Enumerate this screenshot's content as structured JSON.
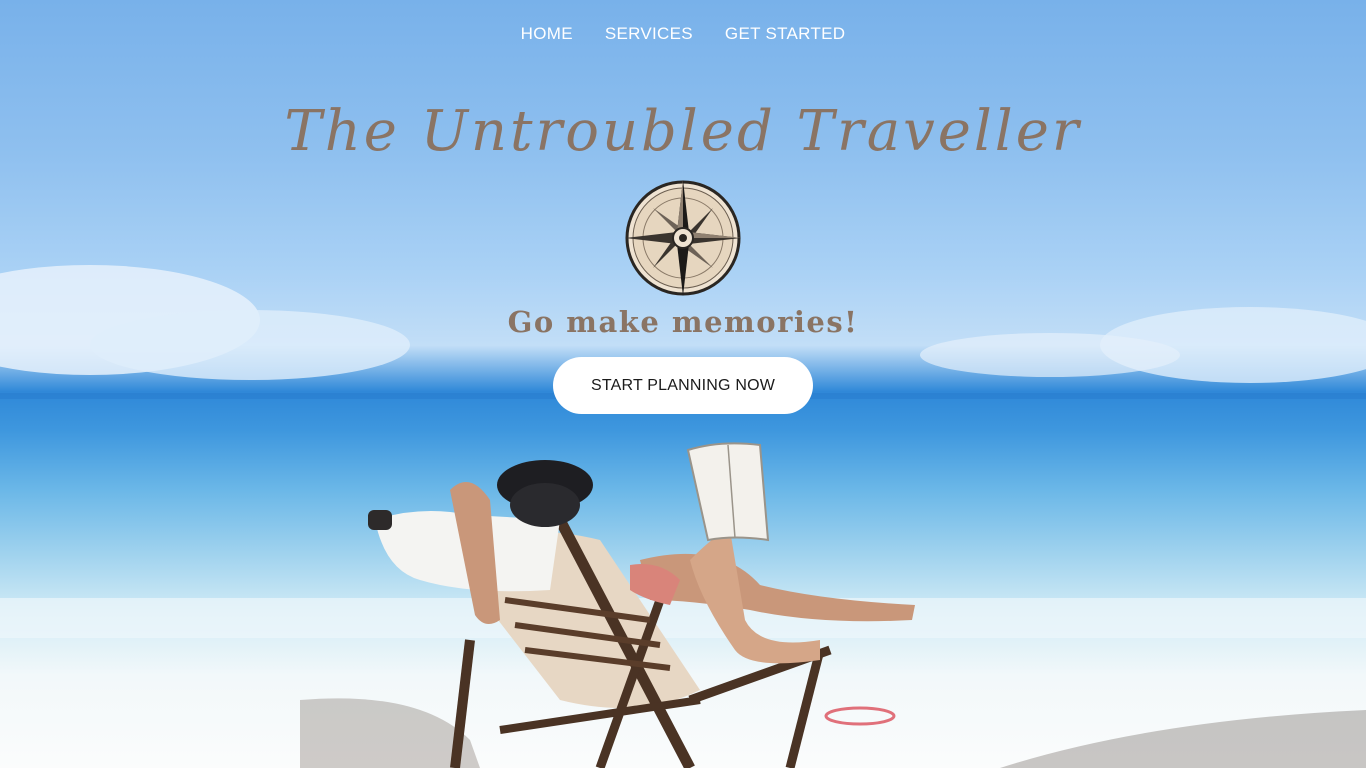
{
  "nav": {
    "items": [
      {
        "label": "HOME"
      },
      {
        "label": "SERVICES"
      },
      {
        "label": "GET STARTED"
      }
    ]
  },
  "hero": {
    "title": "The Untroubled Traveller",
    "tagline": "Go make memories!",
    "cta_label": "START PLANNING NOW",
    "logo_icon": "compass-rose-icon",
    "background_image": "beach-lounger-reader-photo"
  },
  "colors": {
    "title": "#8a7464",
    "nav_text": "#ffffff",
    "cta_bg": "#ffffff",
    "cta_text": "#1b1b1b",
    "sky": "#78b1ea",
    "sea": "#2f88d8",
    "sand": "#fbfcfc"
  }
}
